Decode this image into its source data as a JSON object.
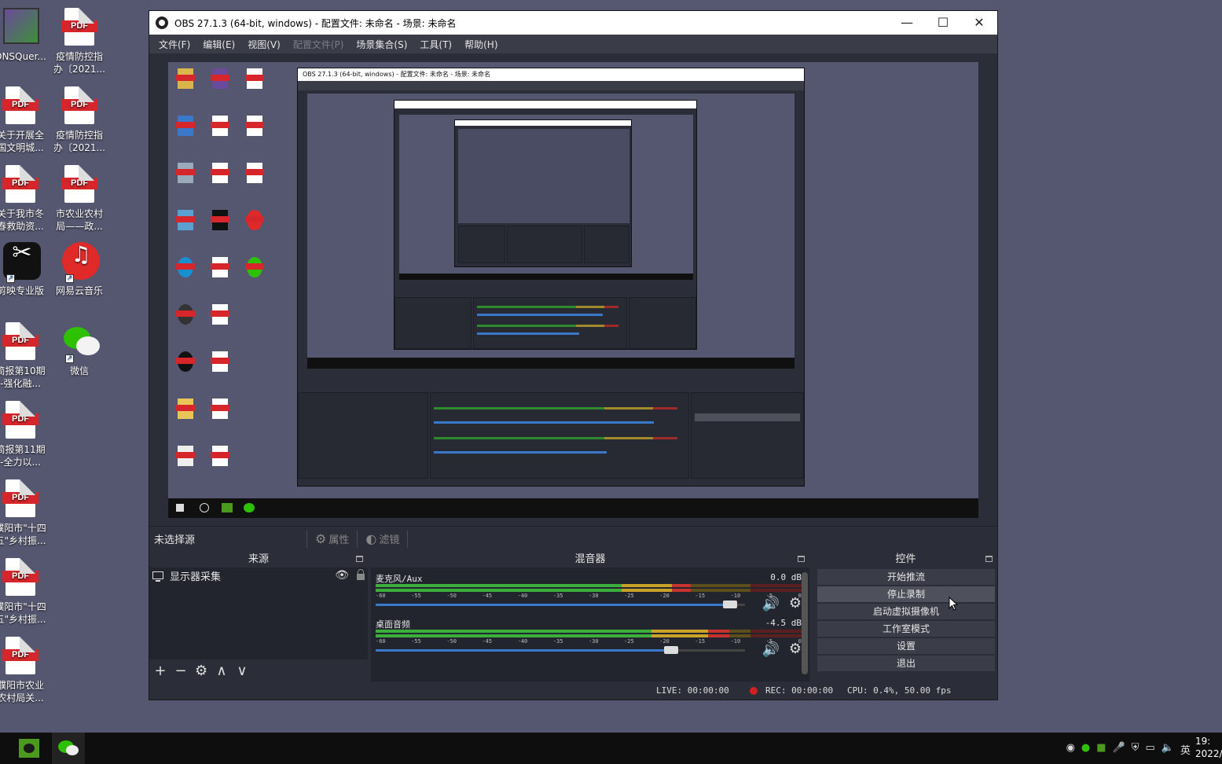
{
  "desktop": {
    "icons": [
      {
        "label_1": "DNSQuer...",
        "label_2": "",
        "type": "dns"
      },
      {
        "label_1": "疫情防控指",
        "label_2": "办〔2021...",
        "type": "pdf"
      },
      {
        "label_1": "关于开展全",
        "label_2": "国文明城...",
        "type": "pdf"
      },
      {
        "label_1": "疫情防控指",
        "label_2": "办〔2021...",
        "type": "pdf"
      },
      {
        "label_1": "关于我市冬",
        "label_2": "春救助资...",
        "type": "pdf"
      },
      {
        "label_1": "市农业农村",
        "label_2": "局——政...",
        "type": "pdf"
      },
      {
        "label_1": "剪映专业版",
        "label_2": "",
        "type": "capcut"
      },
      {
        "label_1": "网易云音乐",
        "label_2": "",
        "type": "netease"
      },
      {
        "label_1": "简报第10期",
        "label_2": "-强化融...",
        "type": "pdf"
      },
      {
        "label_1": "微信",
        "label_2": "",
        "type": "wechat"
      },
      {
        "label_1": "简报第11期",
        "label_2": "-全力以...",
        "type": "pdf"
      },
      {
        "label_1": "濮阳市\"十四",
        "label_2": "五\"乡村振...",
        "type": "pdf"
      },
      {
        "label_1": "濮阳市\"十四",
        "label_2": "五\"乡村振...",
        "type": "pdf"
      },
      {
        "label_1": "濮阳市农业",
        "label_2": "农村局关...",
        "type": "pdf"
      }
    ],
    "pdf_badge": "PDF"
  },
  "obs": {
    "window_title": "OBS 27.1.3 (64-bit, windows) - 配置文件: 未命名 - 场景: 未命名",
    "window_buttons": {
      "minimize": "—",
      "maximize": "☐",
      "close": "✕"
    },
    "menu": [
      {
        "label": "文件(F)",
        "enabled": true
      },
      {
        "label": "编辑(E)",
        "enabled": true
      },
      {
        "label": "视图(V)",
        "enabled": true
      },
      {
        "label": "配置文件(P)",
        "enabled": false
      },
      {
        "label": "场景集合(S)",
        "enabled": true
      },
      {
        "label": "工具(T)",
        "enabled": true
      },
      {
        "label": "帮助(H)",
        "enabled": true
      }
    ],
    "source_toolbar": {
      "no_source": "未选择源",
      "properties": "属性",
      "filters": "滤镜"
    },
    "sources_dock": {
      "title": "来源",
      "items": [
        {
          "label": "显示器采集",
          "visible": true
        }
      ],
      "toolbar": [
        "+",
        "−",
        "⚙",
        "∧",
        "∨"
      ]
    },
    "mixer_dock": {
      "title": "混音器",
      "channels": [
        {
          "name": "麦克风/Aux",
          "db": "0.0 dB",
          "level": 0.74,
          "volume": 0.96
        },
        {
          "name": "桌面音频",
          "db": "-4.5 dB",
          "level": 0.83,
          "volume": 0.8
        }
      ],
      "ticks": [
        "-60",
        "-55",
        "-50",
        "-45",
        "-40",
        "-35",
        "-30",
        "-25",
        "-20",
        "-15",
        "-10",
        "-5",
        "0"
      ]
    },
    "controls_dock": {
      "title": "控件",
      "buttons": [
        "开始推流",
        "停止录制",
        "启动虚拟摄像机",
        "工作室模式",
        "设置",
        "退出"
      ]
    },
    "status": {
      "live": "LIVE: 00:00:00",
      "rec": "REC: 00:00:00",
      "cpu": "CPU: 0.4%, 50.00 fps"
    }
  },
  "taskbar": {
    "tray_icons": [
      "obs-icon",
      "wechat-icon",
      "nvidia-icon",
      "mic-icon",
      "security-icon",
      "network-icon",
      "volume-icon"
    ],
    "ime": "英",
    "clock_time": "19:",
    "clock_date": "2022/"
  },
  "colors": {
    "desktop_bg": "#555770",
    "obs_bg": "#2b2e38",
    "accent_blue": "#3a78c9",
    "rec_red": "#d02020"
  }
}
